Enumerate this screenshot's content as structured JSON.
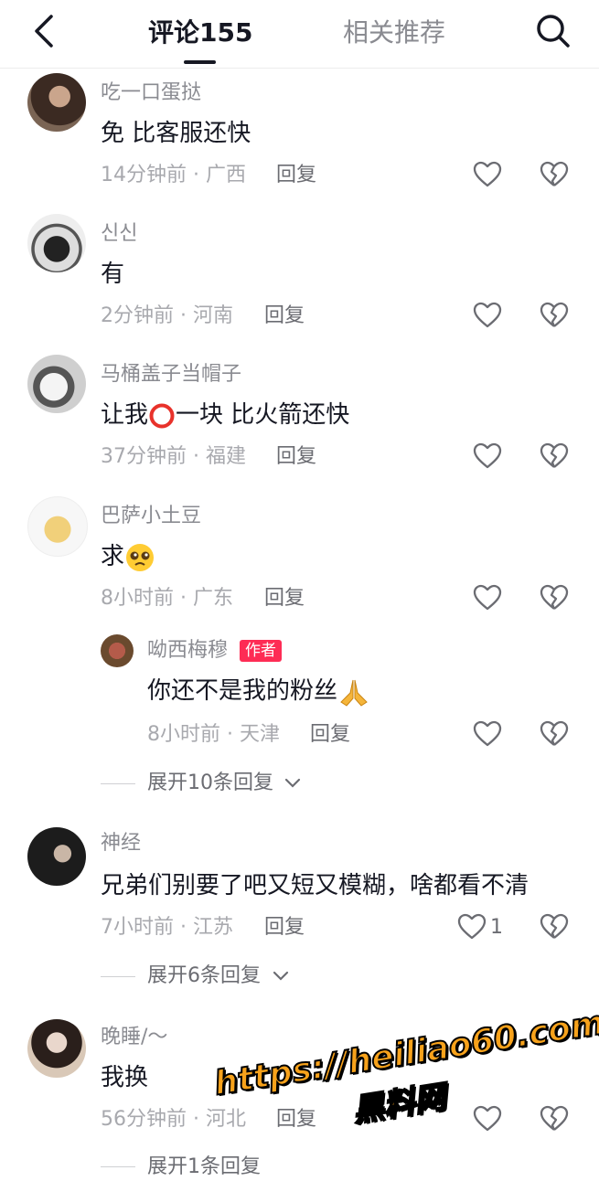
{
  "header": {
    "active_tab": "评论155",
    "inactive_tab": "相关推荐"
  },
  "comments": [
    {
      "user": "吃一口蛋挞",
      "text": "免 比客服还快",
      "meta": "14分钟前 · 广西",
      "reply": "回复"
    },
    {
      "user": "신신",
      "text": "有",
      "meta": "2分钟前 · 河南",
      "reply": "回复"
    },
    {
      "user": "马桶盖子当帽子",
      "text_a": "让我",
      "text_b": "一块 比火箭还快",
      "meta": "37分钟前 · 福建",
      "reply": "回复"
    },
    {
      "user": "巴萨小土豆",
      "text": "求",
      "meta": "8小时前 · 广东",
      "reply": "回复"
    },
    {
      "user": "神经",
      "text": "兄弟们别要了吧又短又模糊，啥都看不清",
      "meta": "7小时前 · 江苏",
      "reply": "回复",
      "likes": "1"
    },
    {
      "user": "晚睡/～",
      "text": "我换",
      "meta": "56分钟前 · 河北",
      "reply": "回复"
    }
  ],
  "author_reply": {
    "user": "呦西梅穆",
    "badge": "作者",
    "text": "你还不是我的粉丝",
    "meta": "8小时前 · 天津",
    "reply": "回复"
  },
  "expanders": [
    "展开10条回复",
    "展开6条回复",
    "展开1条回复"
  ],
  "watermark": {
    "url": "https://heiliao60.com",
    "name": "黑料网"
  },
  "colors": {
    "accent": "#fe2c55",
    "text": "#161823",
    "muted": "#8a8b91"
  }
}
